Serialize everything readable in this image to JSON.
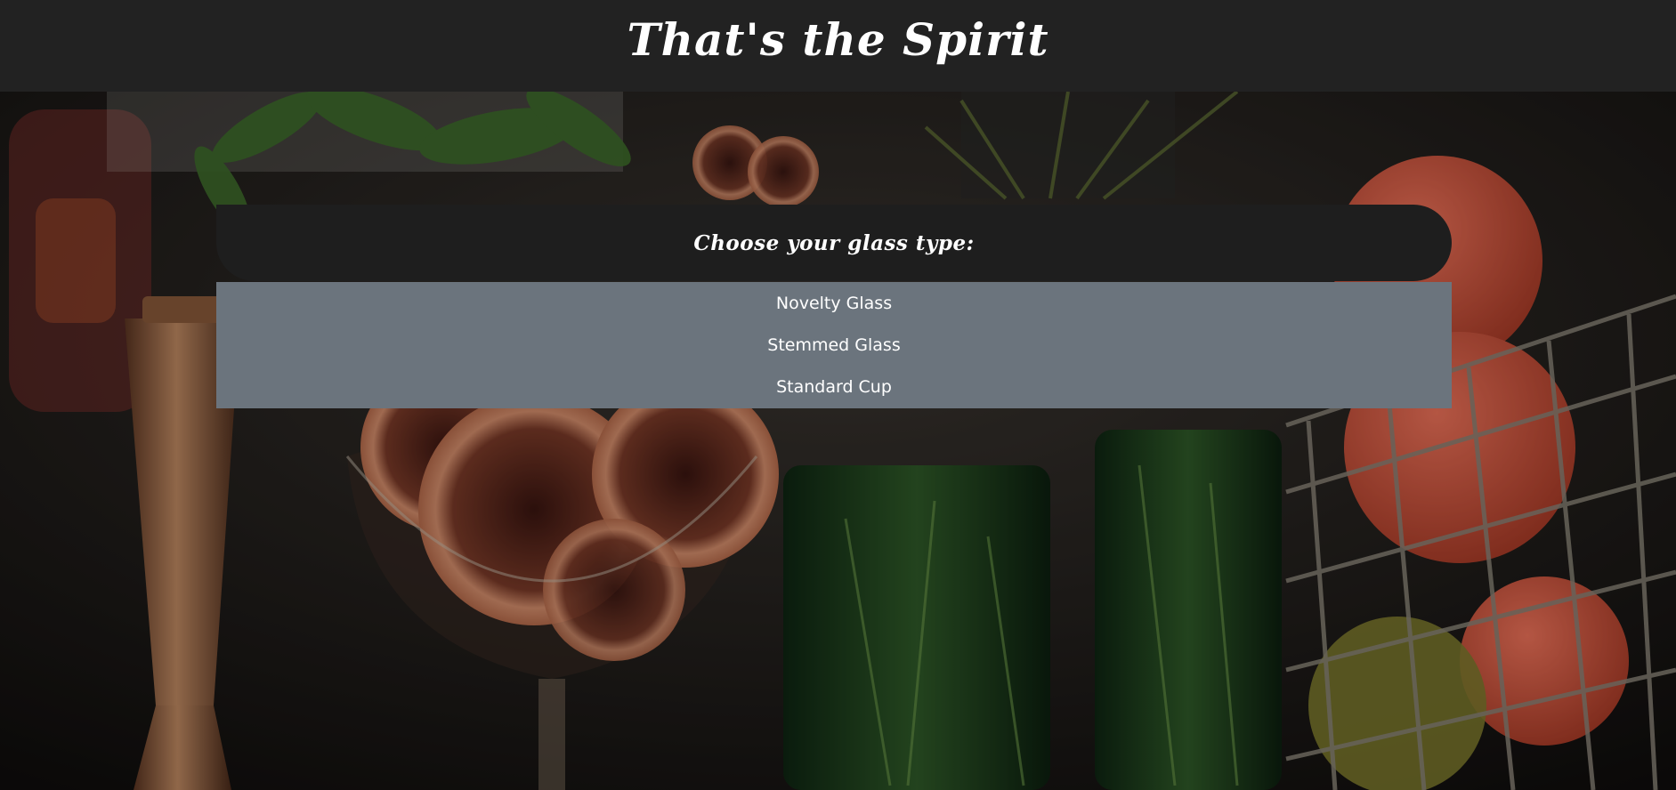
{
  "header": {
    "title": "That's the Spirit"
  },
  "selector": {
    "prompt": "Choose your glass type:",
    "options": [
      {
        "label": "Novelty Glass"
      },
      {
        "label": "Stemmed Glass"
      },
      {
        "label": "Standard Cup"
      }
    ]
  },
  "colors": {
    "header_bg": "#222222",
    "panel_bg": "#1e1e1e",
    "options_bg": "#6b747d",
    "text": "#ffffff"
  }
}
